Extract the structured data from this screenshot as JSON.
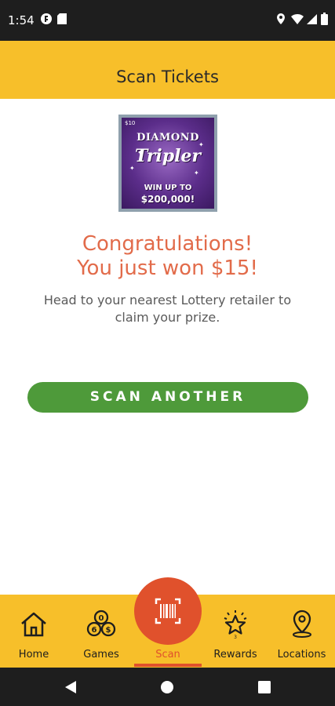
{
  "status_bar": {
    "time": "1:54",
    "icons": [
      "notification-app-icon",
      "sd-card-icon",
      "location-icon",
      "wifi-icon",
      "signal-icon",
      "battery-icon"
    ]
  },
  "header": {
    "title": "Scan Tickets"
  },
  "ticket": {
    "price_label": "$10",
    "title_line1": "DIAMOND",
    "title_line2": "Tripler",
    "win_line1": "WIN UP TO",
    "win_line2": "$200,000!"
  },
  "result": {
    "line1": "Congratulations!",
    "line2": "You just won $15!",
    "instruction": "Head to your nearest Lottery retailer to claim your prize."
  },
  "action": {
    "scan_another_label": "SCAN ANOTHER"
  },
  "bottom_nav": {
    "items": [
      {
        "label": "Home",
        "icon": "home-icon"
      },
      {
        "label": "Games",
        "icon": "games-icon"
      },
      {
        "label": "Scan",
        "icon": "barcode-scan-icon",
        "active": true
      },
      {
        "label": "Rewards",
        "icon": "rewards-star-icon"
      },
      {
        "label": "Locations",
        "icon": "location-pin-icon"
      }
    ]
  },
  "colors": {
    "header_bg": "#f7bf2a",
    "congrats_text": "#e26b4a",
    "button_green": "#4e9a3a",
    "scan_active": "#e0512c"
  }
}
